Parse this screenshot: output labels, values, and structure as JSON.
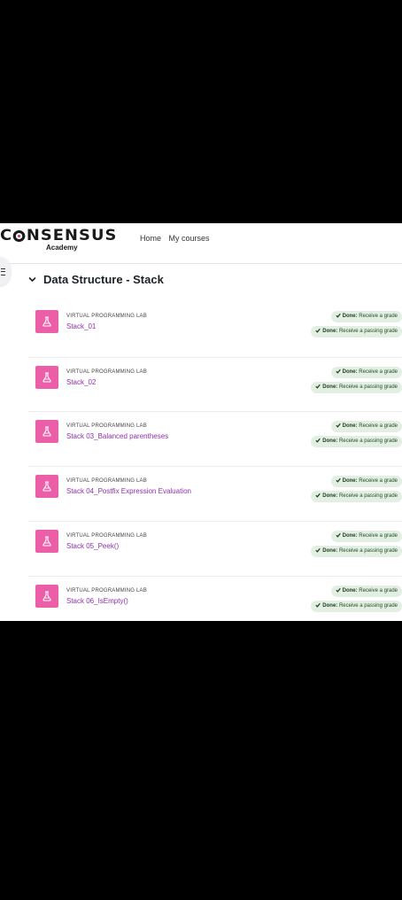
{
  "brand": {
    "logo_text_pre": "C",
    "logo_text_post": "NSENSUS",
    "logo_sub": "Academy",
    "accent": "#e0307f"
  },
  "nav": {
    "home": "Home",
    "my_courses": "My courses"
  },
  "section": {
    "title": "Data Structure - Stack"
  },
  "completion": {
    "done_label": "Done:",
    "receive_grade": "Receive a grade",
    "receive_passing_grade": "Receive a passing grade"
  },
  "activities": [
    {
      "type": "VIRTUAL PROGRAMMING LAB",
      "name": "Stack_01"
    },
    {
      "type": "VIRTUAL PROGRAMMING LAB",
      "name": "Stack_02"
    },
    {
      "type": "VIRTUAL PROGRAMMING LAB",
      "name": "Stack 03_Balanced parentheses"
    },
    {
      "type": "VIRTUAL PROGRAMMING LAB",
      "name": "Stack 04_Postfix Expression Evaluation"
    },
    {
      "type": "VIRTUAL PROGRAMMING LAB",
      "name": "Stack 05_Peek()"
    },
    {
      "type": "VIRTUAL PROGRAMMING LAB",
      "name": "Stack 06_IsEmpty()"
    }
  ],
  "colors": {
    "activity_icon_bg": "#ec5fa8",
    "activity_link": "#8f2fb0",
    "badge_bg": "#e4efe4"
  }
}
